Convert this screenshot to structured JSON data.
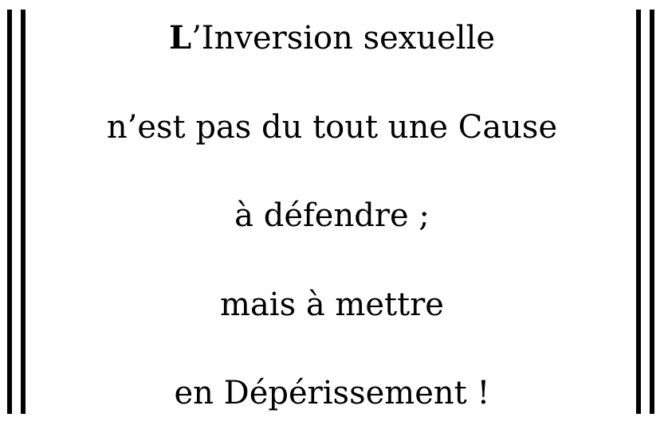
{
  "poem": {
    "line1_initial": "L",
    "line1_rest": "’Inversion sexuelle",
    "line2": "n’est pas du tout une Cause",
    "line3": "à défendre ;",
    "line4": "mais à mettre",
    "line5": "en Dépérissement !"
  }
}
